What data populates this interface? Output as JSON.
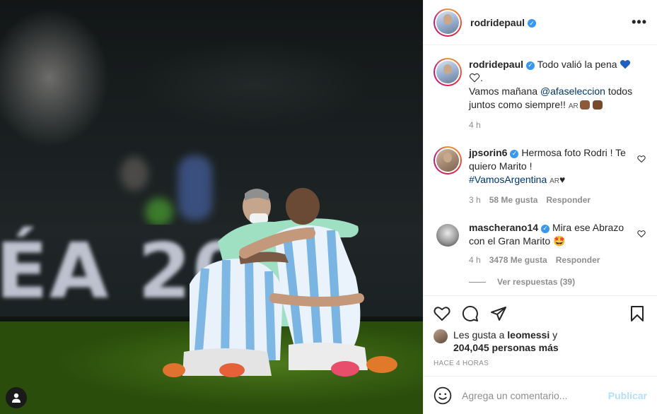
{
  "post": {
    "username": "rodridepaul",
    "verified_icon": "verified-badge-icon",
    "more_icon": "more-options-icon",
    "photo": {
      "board_text": "ÉA 2021"
    }
  },
  "caption": {
    "username": "rodridepaul",
    "text_1": "Todo valió la pena",
    "text_2": ".",
    "line_2_a": "Vamos mañana",
    "mention": "@afaseleccion",
    "line_2_b": "todos juntos como siempre!!",
    "flag_text": "AR",
    "time": "4 h"
  },
  "comments": [
    {
      "username": "jpsorin6",
      "text_1": "Hermosa foto Rodri ! Te quiero Marito !",
      "hashtag": "#VamosArgentina",
      "flag_text": "AR",
      "heart_glyph": "♥",
      "time": "3 h",
      "likes": "58 Me gusta",
      "reply": "Responder"
    },
    {
      "username": "mascherano14",
      "text_1": "Mira ese Abrazo con el Gran Marito",
      "emoji": "🤩",
      "time": "4 h",
      "likes": "3478 Me gusta",
      "reply": "Responder"
    }
  ],
  "view_replies": "Ver respuestas (39)",
  "actions": {
    "like_icon": "heart-icon",
    "comment_icon": "comment-icon",
    "share_icon": "share-icon",
    "save_icon": "bookmark-icon"
  },
  "likes": {
    "prefix": "Les gusta a",
    "user": "leomessi",
    "middle": "y",
    "count": "204,045 personas más"
  },
  "timestamp": "HACE 4 HORAS",
  "add_comment": {
    "placeholder": "Agrega un comentario...",
    "publish": "Publicar",
    "emoji_icon": "smiley-icon"
  },
  "colors": {
    "verified": "#3897f0",
    "link": "#00376b",
    "muted": "#8e8e8e",
    "publish_disabled": "#b2dffc"
  }
}
